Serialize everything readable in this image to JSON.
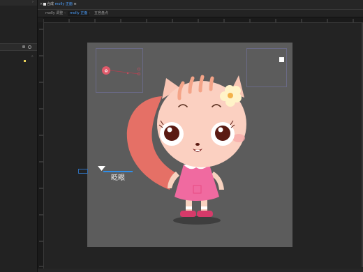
{
  "breadcrumb": {
    "items": [
      "合成",
      "molly 正面"
    ]
  },
  "tabs": [
    {
      "label": "molly 调整",
      "active": false
    },
    {
      "label": "molly 正面",
      "active": true
    },
    {
      "label": "五官盘点",
      "active": false
    }
  ],
  "rig": {
    "label": "眨眼"
  },
  "colors": {
    "accent": "#4da0ff",
    "artboard": "#5c5c5c",
    "dress": "#f06aa0"
  }
}
